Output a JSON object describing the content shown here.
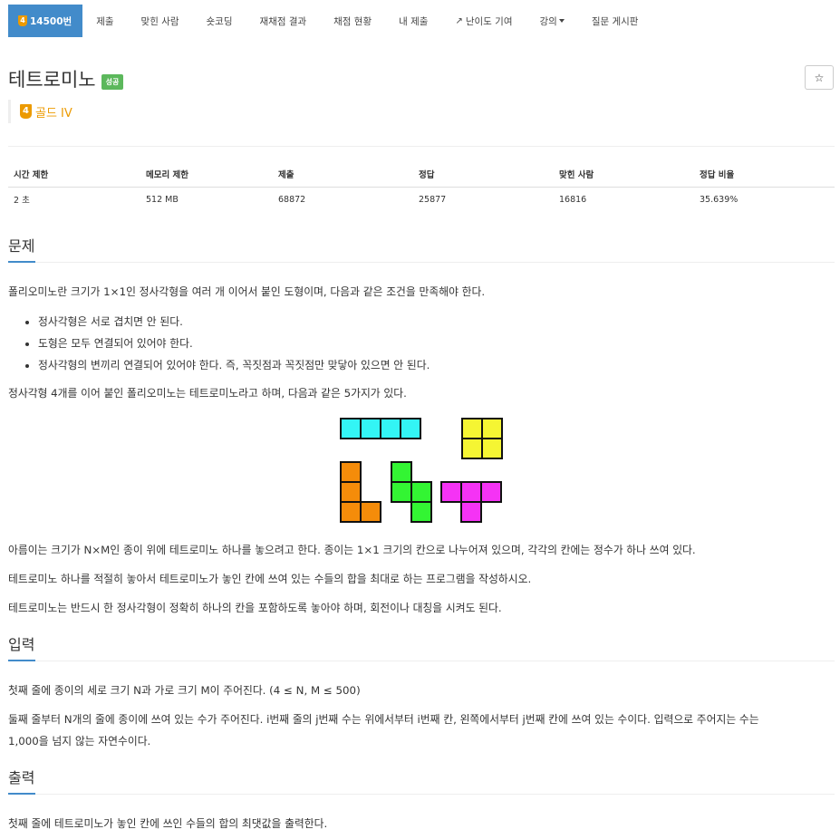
{
  "nav": {
    "problem_tab": {
      "tier": "4",
      "label": "14500번"
    },
    "items": [
      {
        "label": "제출"
      },
      {
        "label": "맞힌 사람"
      },
      {
        "label": "숏코딩"
      },
      {
        "label": "재채점 결과"
      },
      {
        "label": "채점 현황"
      },
      {
        "label": "내 제출"
      },
      {
        "label": "난이도 기여",
        "icon": "external-link-icon"
      },
      {
        "label": "강의",
        "icon": "caret-down-icon"
      },
      {
        "label": "질문 게시판"
      }
    ]
  },
  "problem": {
    "title": "테트로미노",
    "status": "성공",
    "tier_number": "4",
    "tier_label": "골드 IV",
    "star": "☆"
  },
  "stats": {
    "headers": [
      "시간 제한",
      "메모리 제한",
      "제출",
      "정답",
      "맞힌 사람",
      "정답 비율"
    ],
    "values": [
      "2 초",
      "512 MB",
      "68872",
      "25877",
      "16816",
      "35.639%"
    ]
  },
  "sections": {
    "problem": {
      "title": "문제",
      "intro": "폴리오미노란 크기가 1×1인 정사각형을 여러 개 이어서 붙인 도형이며, 다음과 같은 조건을 만족해야 한다.",
      "rules": [
        "정사각형은 서로 겹치면 안 된다.",
        "도형은 모두 연결되어 있어야 한다.",
        "정사각형의 변끼리 연결되어 있어야 한다. 즉, 꼭짓점과 꼭짓점만 맞닿아 있으면 안 된다."
      ],
      "tetromino_intro": "정사각형 4개를 이어 붙인 폴리오미노는 테트로미노라고 하며, 다음과 같은 5가지가 있다.",
      "figure_colors": {
        "I": "#33f5f5",
        "O": "#f5f533",
        "L": "#f58c0a",
        "S": "#33f533",
        "T": "#f533f5"
      },
      "para1": "아름이는 크기가 N×M인 종이 위에 테트로미노 하나를 놓으려고 한다. 종이는 1×1 크기의 칸으로 나누어져 있으며, 각각의 칸에는 정수가 하나 쓰여 있다.",
      "para2": "테트로미노 하나를 적절히 놓아서 테트로미노가 놓인 칸에 쓰여 있는 수들의 합을 최대로 하는 프로그램을 작성하시오.",
      "para3": "테트로미노는 반드시 한 정사각형이 정확히 하나의 칸을 포함하도록 놓아야 하며, 회전이나 대칭을 시켜도 된다."
    },
    "input": {
      "title": "입력",
      "line1": "첫째 줄에 종이의 세로 크기 N과 가로 크기 M이 주어진다. (4 ≤ N, M ≤ 500)",
      "line2a": "둘째 줄부터 N개의 줄에 종이에 쓰여 있는 수가 주어진다. i번째 줄의 j번째 수는 위에서부터 i번째 칸, 왼쪽에서부터 j번째 칸에 쓰여 있는 수이다. 입력으로 주어지는 수는",
      "line2b": "1,000을 넘지 않는 자연수이다."
    },
    "output": {
      "title": "출력",
      "line1": "첫째 줄에 테트로미노가 놓인 칸에 쓰인 수들의 합의 최댓값을 출력한다."
    }
  },
  "accent": "#428bca",
  "tier_color": "#ec9a00",
  "success_color": "#5cb85c"
}
